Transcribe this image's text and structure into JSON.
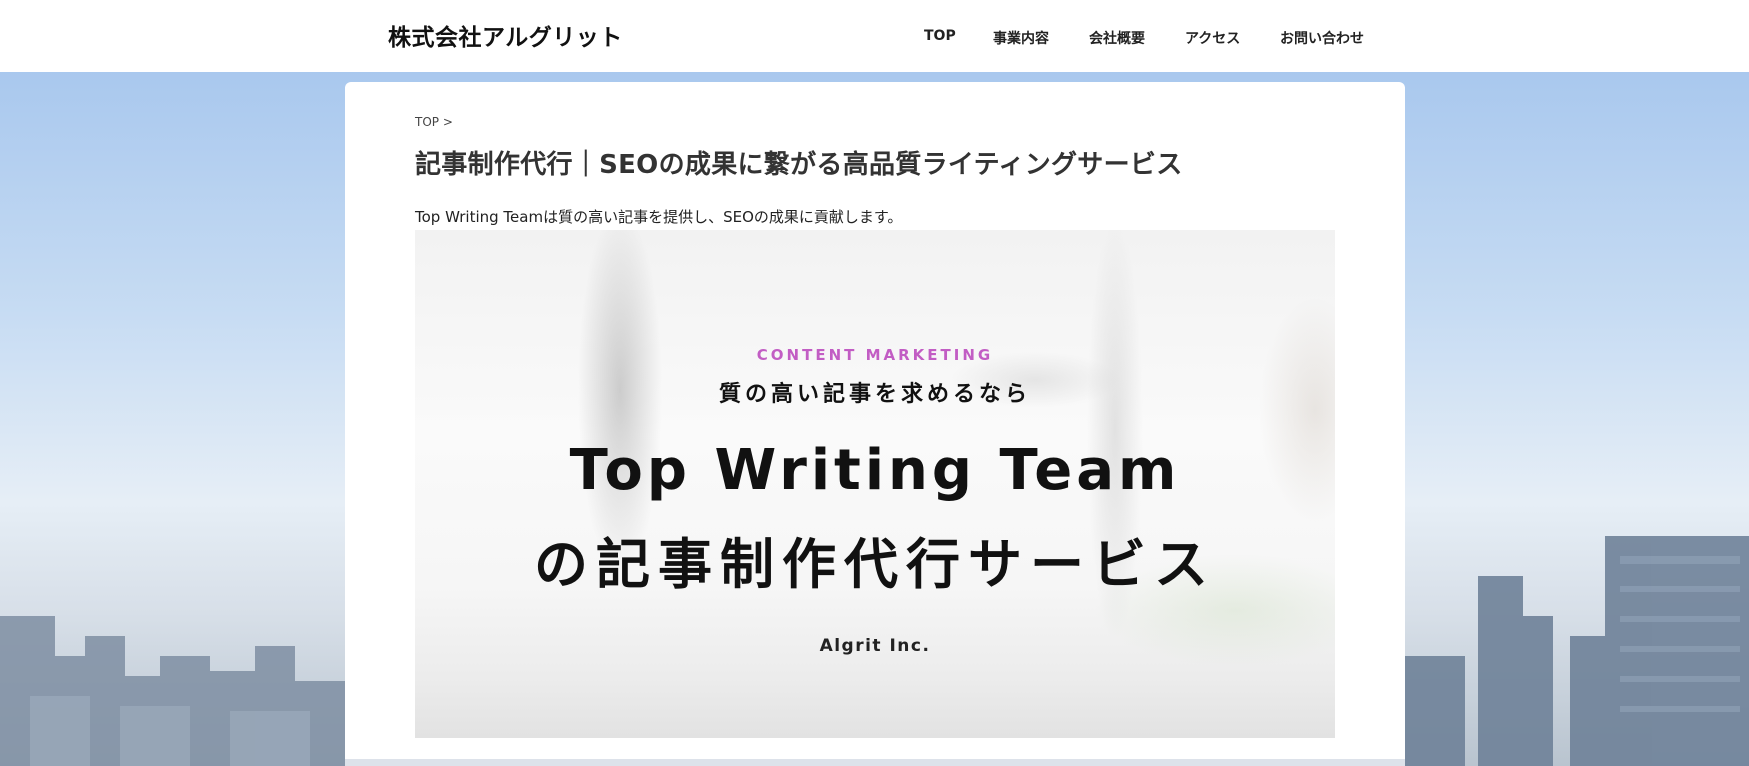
{
  "header": {
    "logo": "株式会社アルグリット",
    "nav": [
      {
        "label": "TOP",
        "name": "nav-top"
      },
      {
        "label": "事業内容",
        "name": "nav-business"
      },
      {
        "label": "会社概要",
        "name": "nav-company"
      },
      {
        "label": "アクセス",
        "name": "nav-access"
      },
      {
        "label": "お問い合わせ",
        "name": "nav-contact"
      }
    ]
  },
  "main": {
    "breadcrumb": "TOP >",
    "title": "記事制作代行｜SEOの成果に繋がる高品質ライティングサービス",
    "lead": "Top Writing Teamは質の高い記事を提供し、SEOの成果に貢献します。",
    "hero": {
      "kicker": "CONTENT MARKETING",
      "sub": "質の高い記事を求めるなら",
      "title_line1": "Top Writing Team",
      "title_line2": "の記事制作代行サービス",
      "company": "Algrit Inc."
    }
  },
  "colors": {
    "kicker": "#c25dc4",
    "sky": "#a9c8ee"
  }
}
